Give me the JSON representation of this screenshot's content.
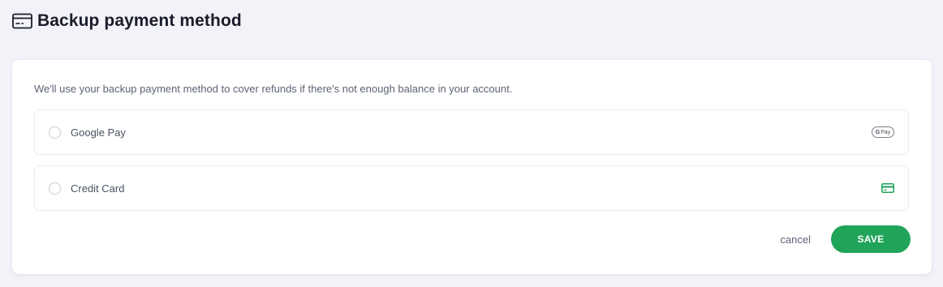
{
  "header": {
    "icon": "credit-card-icon",
    "title": "Backup payment method"
  },
  "card": {
    "description": "We'll use your backup payment method to cover refunds if there's not enough balance in your account.",
    "options": [
      {
        "label": "Google Pay",
        "selected": false,
        "icon": "google-pay-icon",
        "icon_text_g": "G",
        "icon_text_pay": "Pay"
      },
      {
        "label": "Credit Card",
        "selected": false,
        "icon": "credit-card-icon",
        "icon_color": "#20a45a"
      }
    ],
    "actions": {
      "cancel_label": "cancel",
      "save_label": "SAVE"
    }
  },
  "colors": {
    "background": "#f2f3f8",
    "accent": "#20a45a",
    "title": "#1b1b2b",
    "muted_text": "#5b6373"
  }
}
